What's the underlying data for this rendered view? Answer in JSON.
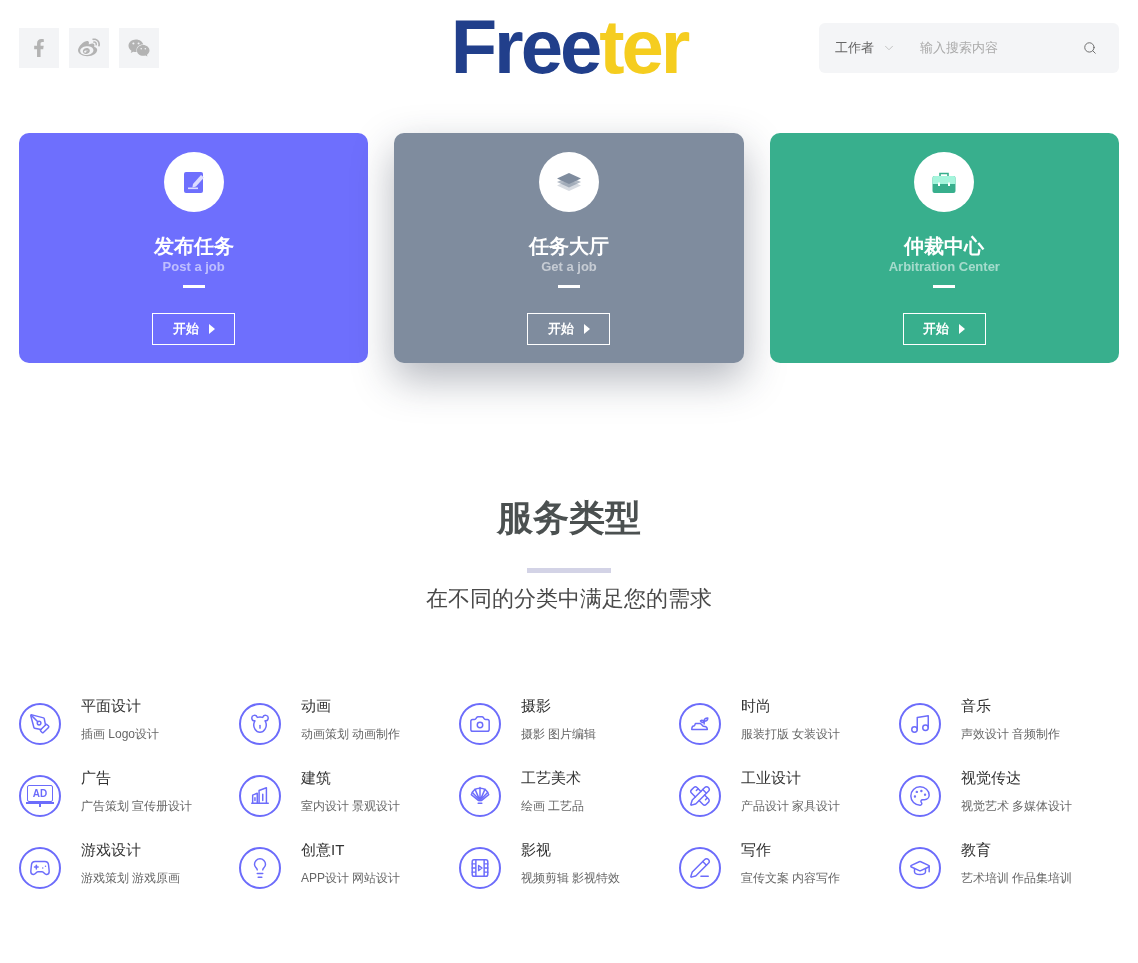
{
  "logo": {
    "primary": "Free",
    "accent": "ter"
  },
  "search": {
    "scope": "工作者",
    "placeholder": "输入搜索内容"
  },
  "cards": [
    {
      "title": "发布任务",
      "subtitle": "Post a job",
      "button": "开始",
      "color": "#6e6ffd",
      "elevated": false
    },
    {
      "title": "任务大厅",
      "subtitle": "Get a job",
      "button": "开始",
      "color": "#7f8c9e",
      "elevated": true
    },
    {
      "title": "仲裁中心",
      "subtitle": "Arbitration Center",
      "button": "开始",
      "color": "#38af8d",
      "elevated": false
    }
  ],
  "services": {
    "title": "服务类型",
    "subtitle": "在不同的分类中满足您的需求",
    "items": [
      {
        "name": "平面设计",
        "tags": "插画 Logo设计"
      },
      {
        "name": "动画",
        "tags": "动画策划 动画制作"
      },
      {
        "name": "摄影",
        "tags": "摄影 图片编辑"
      },
      {
        "name": "时尚",
        "tags": "服装打版 女装设计"
      },
      {
        "name": "音乐",
        "tags": "声效设计 音频制作"
      },
      {
        "name": "广告",
        "tags": "广告策划 宣传册设计",
        "icon_label": "AD"
      },
      {
        "name": "建筑",
        "tags": "室内设计 景观设计"
      },
      {
        "name": "工艺美术",
        "tags": "绘画 工艺品"
      },
      {
        "name": "工业设计",
        "tags": "产品设计 家具设计"
      },
      {
        "name": "视觉传达",
        "tags": "视觉艺术 多媒体设计"
      },
      {
        "name": "游戏设计",
        "tags": "游戏策划 游戏原画"
      },
      {
        "name": "创意IT",
        "tags": "APP设计 网站设计"
      },
      {
        "name": "影视",
        "tags": "视频剪辑 影视特效"
      },
      {
        "name": "写作",
        "tags": "宣传文案 内容写作"
      },
      {
        "name": "教育",
        "tags": "艺术培训 作品集培训"
      }
    ]
  }
}
